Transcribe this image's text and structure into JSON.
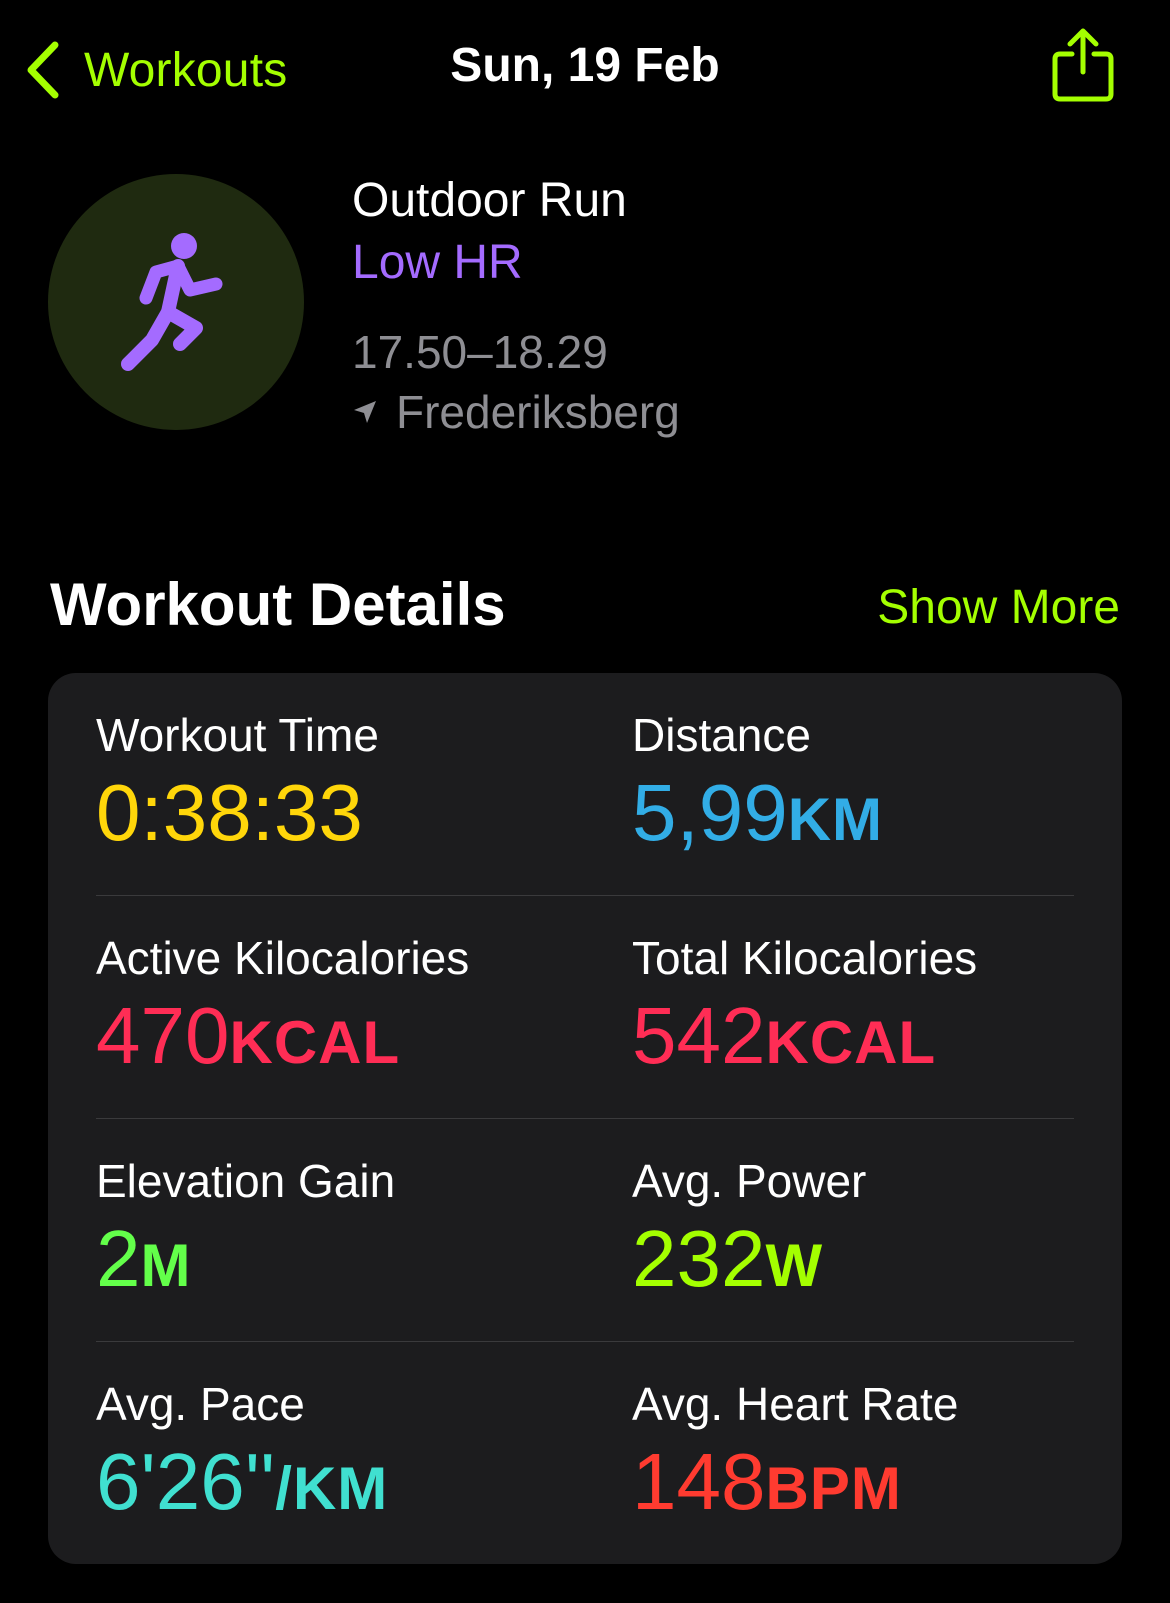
{
  "nav": {
    "back_label": "Workouts",
    "title": "Sun, 19 Feb",
    "share_icon": "share-icon",
    "back_icon": "chevron-left-icon"
  },
  "header": {
    "icon": "running-figure-icon",
    "name": "Outdoor Run",
    "subtitle": "Low HR",
    "time_range": "17.50–18.29",
    "location_icon": "location-arrow-icon",
    "location": "Frederiksberg"
  },
  "section": {
    "title": "Workout Details",
    "show_more": "Show More"
  },
  "colors": {
    "accent": "#a4ff00",
    "subtitle": "#a46bff",
    "time": "#ffd60a",
    "distance": "#32ade6",
    "calories": "#ff2d55",
    "elevation": "#63ff4a",
    "power": "#a4ff00",
    "pace": "#40e0d0",
    "heart_rate": "#ff3b30"
  },
  "metrics": {
    "workout_time": {
      "label": "Workout Time",
      "value": "0:38:33",
      "unit": ""
    },
    "distance": {
      "label": "Distance",
      "value": "5,99",
      "unit": "KM"
    },
    "active_kcal": {
      "label": "Active Kilocalories",
      "value": "470",
      "unit": "KCAL"
    },
    "total_kcal": {
      "label": "Total Kilocalories",
      "value": "542",
      "unit": "KCAL"
    },
    "elevation": {
      "label": "Elevation Gain",
      "value": "2",
      "unit": "M"
    },
    "power": {
      "label": "Avg. Power",
      "value": "232",
      "unit": "W"
    },
    "pace": {
      "label": "Avg. Pace",
      "value": "6'26''",
      "unit": "/KM"
    },
    "heart_rate": {
      "label": "Avg. Heart Rate",
      "value": "148",
      "unit": "BPM"
    }
  }
}
